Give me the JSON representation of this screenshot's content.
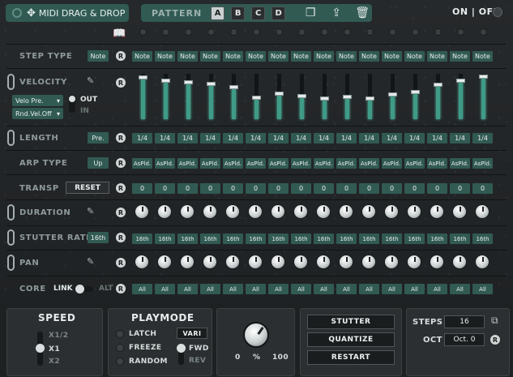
{
  "header": {
    "midi_label": "MIDI DRAG & DROP",
    "pattern_label": "PATTERN",
    "patterns": [
      "A",
      "B",
      "C",
      "D"
    ],
    "onoff": "ON | OFF"
  },
  "rows": {
    "step_type": {
      "label": "STEP TYPE",
      "master": "Note",
      "values": [
        "Note",
        "Note",
        "Note",
        "Note",
        "Note",
        "Note",
        "Note",
        "Note",
        "Note",
        "Note",
        "Note",
        "Note",
        "Note",
        "Note",
        "Note",
        "Note"
      ]
    },
    "velocity": {
      "label": "VELOCITY",
      "mode_select": "Velo Pre.",
      "rnd_select": "Rnd.Vel.Off",
      "out_label": "OUT",
      "in_label": "IN",
      "levels": [
        0.92,
        0.86,
        0.82,
        0.78,
        0.72,
        0.48,
        0.58,
        0.52,
        0.46,
        0.5,
        0.46,
        0.56,
        0.6,
        0.76,
        0.86,
        0.94
      ]
    },
    "length": {
      "label": "LENGTH",
      "master": "Pre.",
      "values": [
        "1/4",
        "1/4",
        "1/4",
        "1/4",
        "1/4",
        "1/4",
        "1/4",
        "1/4",
        "1/4",
        "1/4",
        "1/4",
        "1/4",
        "1/4",
        "1/4",
        "1/4",
        "1/4"
      ]
    },
    "arp_type": {
      "label": "ARP TYPE",
      "master": "Up",
      "values": [
        "AsPld.",
        "AsPld.",
        "AsPld.",
        "AsPld.",
        "AsPld.",
        "AsPld.",
        "AsPld.",
        "AsPld.",
        "AsPld.",
        "AsPld.",
        "AsPld.",
        "AsPld.",
        "AsPld.",
        "AsPld.",
        "AsPld.",
        "AsPld."
      ]
    },
    "transp": {
      "label": "TRANSP",
      "reset_label": "RESET",
      "values": [
        "0",
        "0",
        "0",
        "0",
        "0",
        "0",
        "0",
        "0",
        "0",
        "0",
        "0",
        "0",
        "0",
        "0",
        "0",
        "0"
      ]
    },
    "duration": {
      "label": "DURATION"
    },
    "stutter_rate": {
      "label": "STUTTER RATE",
      "master": "16th",
      "values": [
        "16th",
        "16th",
        "16th",
        "16th",
        "16th",
        "16th",
        "16th",
        "16th",
        "16th",
        "16th",
        "16th",
        "16th",
        "16th",
        "16th",
        "16th",
        "16th"
      ]
    },
    "pan": {
      "label": "PAN"
    },
    "core": {
      "label": "CORE",
      "link_label": "LINK",
      "alt_label": "ALT",
      "values": [
        "All",
        "All",
        "All",
        "All",
        "All",
        "All",
        "All",
        "All",
        "All",
        "All",
        "All",
        "All",
        "All",
        "All",
        "All",
        "All"
      ]
    }
  },
  "reset_glyph": "R",
  "speed": {
    "title": "SPEED",
    "options": [
      "X1/2",
      "X1",
      "X2"
    ],
    "selected": "X1"
  },
  "playmode": {
    "title": "PLAYMODE",
    "options": [
      "LATCH",
      "FREEZE",
      "RANDOM"
    ],
    "vari_label": "VARI",
    "fwd_label": "FWD",
    "rev_label": "REV"
  },
  "mix_knob": {
    "min": "0",
    "unit": "%",
    "max": "100"
  },
  "actions": {
    "stutter": "STUTTER",
    "quantize": "QUANTIZE",
    "restart": "RESTART"
  },
  "steps": {
    "label": "STEPS",
    "value": "16"
  },
  "oct": {
    "label": "OCT",
    "value": "Oct. 0"
  },
  "colors": {
    "accent": "#315a53",
    "velocity_fill": "#3f9a86"
  },
  "icons": [
    "circle-icon",
    "move-icon",
    "copy-icon",
    "export-icon",
    "trash-icon",
    "book-icon",
    "chain-link-icon",
    "pencil-icon",
    "window-icon"
  ]
}
